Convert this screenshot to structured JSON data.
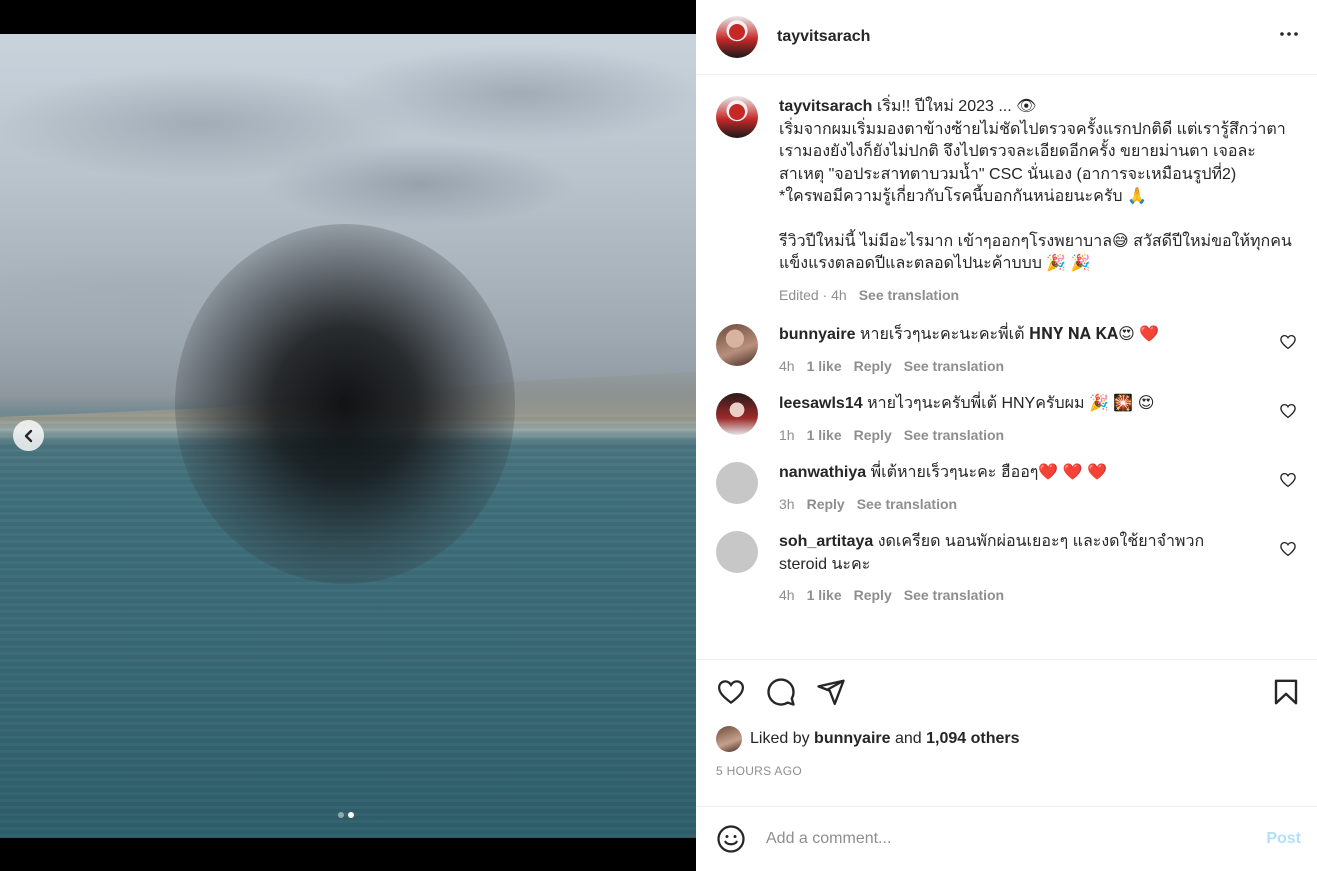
{
  "post": {
    "author": "tayvitsarach",
    "caption": {
      "line1": "เริ่ม!! ปีใหม่ 2023 ... 👁",
      "line2": "เริ่มจากผมเริ่มมองตาข้างซ้ายไม่ชัดไปตรวจครั้งแรกปกติดี แต่เรารู้สึกว่าตาเรามองยังไงก็ยังไม่ปกติ จึงไปตรวจละเอียดอีกครั้ง ขยายม่านตา เจอละสาเหตุ \"จอประสาทตาบวมน้ำ\" CSC นั่นเอง (อาการจะเหมือนรูปที่2)",
      "line3": "*ใครพอมีความรู้เกี่ยวกับโรคนี้บอกกันหน่อยนะครับ 🙏",
      "line4": "รีวิวปีใหม่นี้ ไม่มีอะไรมาก เข้าๆออกๆโรงพยาบาล😅 สวัสดีปีใหม่ขอให้ทุกคนแข็งแรงตลอดปีและตลอดไปนะค้าบบบ 🎉 🎉",
      "edited": "Edited · 4h",
      "see_translation": "See translation"
    },
    "carousel": {
      "current": 2,
      "total": 2
    }
  },
  "comments": [
    {
      "user": "bunnyaire",
      "text": "หายเร็วๆนะคะนะคะพี่เต้ 𝐇𝐍𝐘 𝐍𝐀 𝐊𝐀😍 ❤️",
      "time": "4h",
      "likes": "1 like",
      "reply": "Reply",
      "translate": "See translation"
    },
    {
      "user": "leesawls14",
      "text": "หายไวๆนะครับพี่เต้ HNYครับผม 🎉 🎇 😍",
      "time": "1h",
      "likes": "1 like",
      "reply": "Reply",
      "translate": "See translation"
    },
    {
      "user": "nanwathiya",
      "text": "พี่เต้หายเร็วๆนะคะ ฮืออๆ❤️ ❤️ ❤️",
      "time": "3h",
      "likes": "",
      "reply": "Reply",
      "translate": "See translation"
    },
    {
      "user": "soh_artitaya",
      "text": "งดเครียด นอนพักผ่อนเยอะๆ และงดใช้ยาจำพวก steroid นะคะ",
      "time": "4h",
      "likes": "1 like",
      "reply": "Reply",
      "translate": "See translation"
    }
  ],
  "likes": {
    "prefix": "Liked by",
    "user": "bunnyaire",
    "and": "and",
    "count": "1,094 others"
  },
  "timestamp": "5 HOURS AGO",
  "add_comment": {
    "placeholder": "Add a comment...",
    "post_label": "Post"
  },
  "icons": {
    "more": "more-options-icon",
    "like": "heart-icon",
    "comment": "comment-icon",
    "share": "share-icon",
    "save": "bookmark-icon",
    "emoji": "emoji-icon",
    "prev": "chevron-left-icon"
  },
  "colors": {
    "accent_disabled": "#b2dffc",
    "muted": "#8e8e8e",
    "text": "#262626"
  }
}
